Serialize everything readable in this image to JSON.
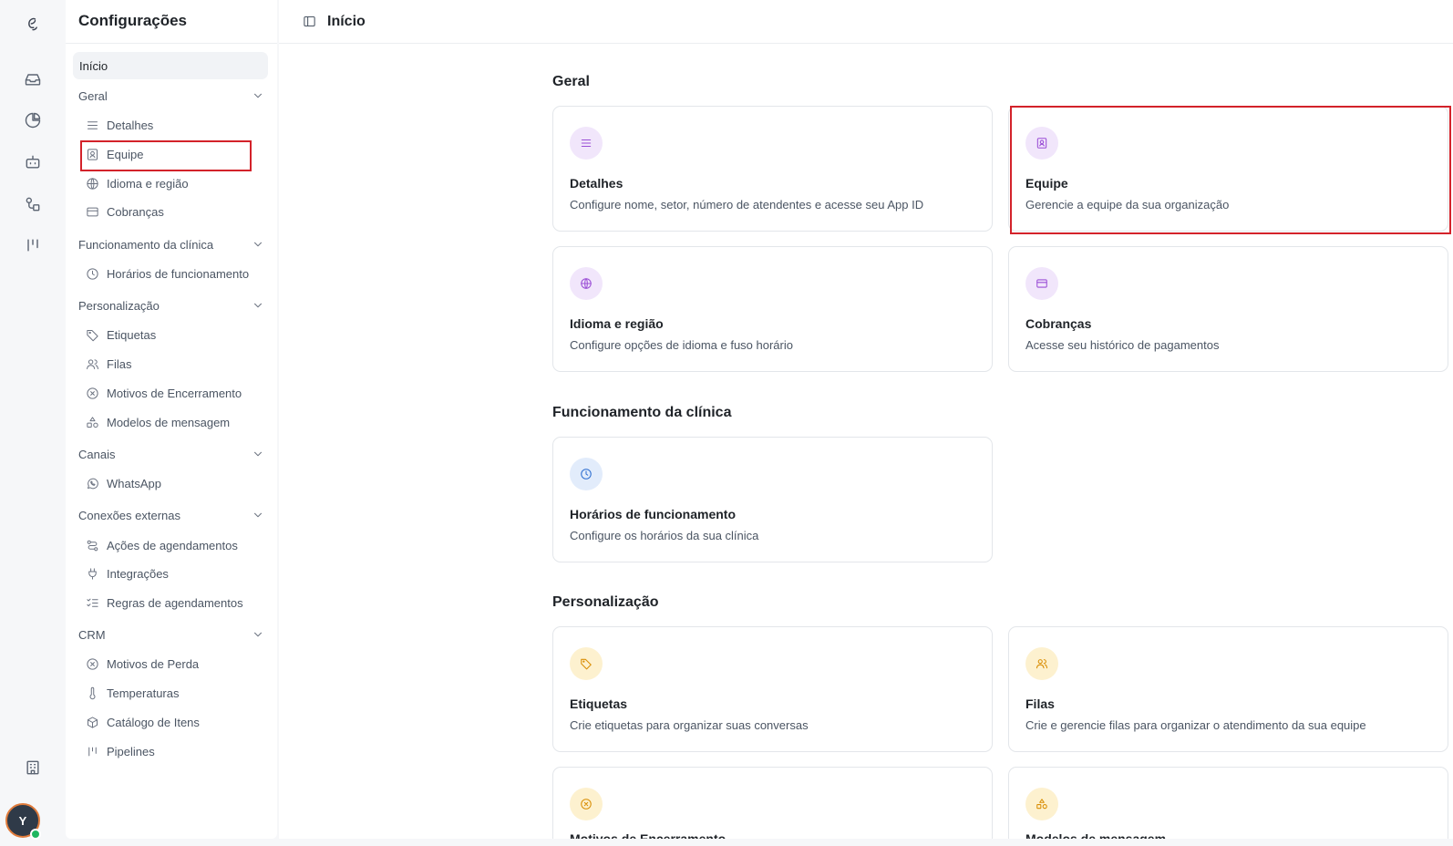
{
  "sidebar": {
    "title": "Configurações",
    "home": "Início",
    "sections": [
      {
        "label": "Geral",
        "items": [
          "Detalhes",
          "Equipe",
          "Idioma e região",
          "Cobranças"
        ]
      },
      {
        "label": "Funcionamento da clínica",
        "items": [
          "Horários de funcionamento"
        ]
      },
      {
        "label": "Personalização",
        "items": [
          "Etiquetas",
          "Filas",
          "Motivos de Encerramento",
          "Modelos de mensagem"
        ]
      },
      {
        "label": "Canais",
        "items": [
          "WhatsApp"
        ]
      },
      {
        "label": "Conexões externas",
        "items": [
          "Ações de agendamentos",
          "Integrações",
          "Regras de agendamentos"
        ]
      },
      {
        "label": "CRM",
        "items": [
          "Motivos de Perda",
          "Temperaturas",
          "Catálogo de Itens",
          "Pipelines"
        ]
      }
    ]
  },
  "user": {
    "initial": "Y"
  },
  "header": {
    "title": "Início"
  },
  "main": {
    "sections": [
      {
        "title": "Geral",
        "cards": [
          {
            "title": "Detalhes",
            "desc": "Configure nome, setor, número de atendentes e acesse seu App ID",
            "icon": "list-icon",
            "color": "purple"
          },
          {
            "title": "Equipe",
            "desc": "Gerencie a equipe da sua organização",
            "icon": "contact-icon",
            "color": "purple"
          },
          {
            "title": "Idioma e região",
            "desc": "Configure opções de idioma e fuso horário",
            "icon": "globe-icon",
            "color": "purple"
          },
          {
            "title": "Cobranças",
            "desc": "Acesse seu histórico de pagamentos",
            "icon": "credit-card-icon",
            "color": "purple"
          }
        ]
      },
      {
        "title": "Funcionamento da clínica",
        "cards": [
          {
            "title": "Horários de funcionamento",
            "desc": "Configure os horários da sua clínica",
            "icon": "clock-icon",
            "color": "blue"
          }
        ]
      },
      {
        "title": "Personalização",
        "cards": [
          {
            "title": "Etiquetas",
            "desc": "Crie etiquetas para organizar suas conversas",
            "icon": "tag-icon",
            "color": "yellow"
          },
          {
            "title": "Filas",
            "desc": "Crie e gerencie filas para organizar o atendimento da sua equipe",
            "icon": "users-icon",
            "color": "yellow"
          },
          {
            "title": "Motivos de Encerramento",
            "desc": "",
            "icon": "x-circle-icon",
            "color": "yellow"
          },
          {
            "title": "Modelos de mensagem",
            "desc": "",
            "icon": "shapes-icon",
            "color": "yellow"
          }
        ]
      }
    ]
  },
  "colors": {
    "highlight": "#d3222a",
    "purple": "#9b4fd6",
    "blue": "#2f6fd1",
    "yellow": "#d98e05"
  }
}
